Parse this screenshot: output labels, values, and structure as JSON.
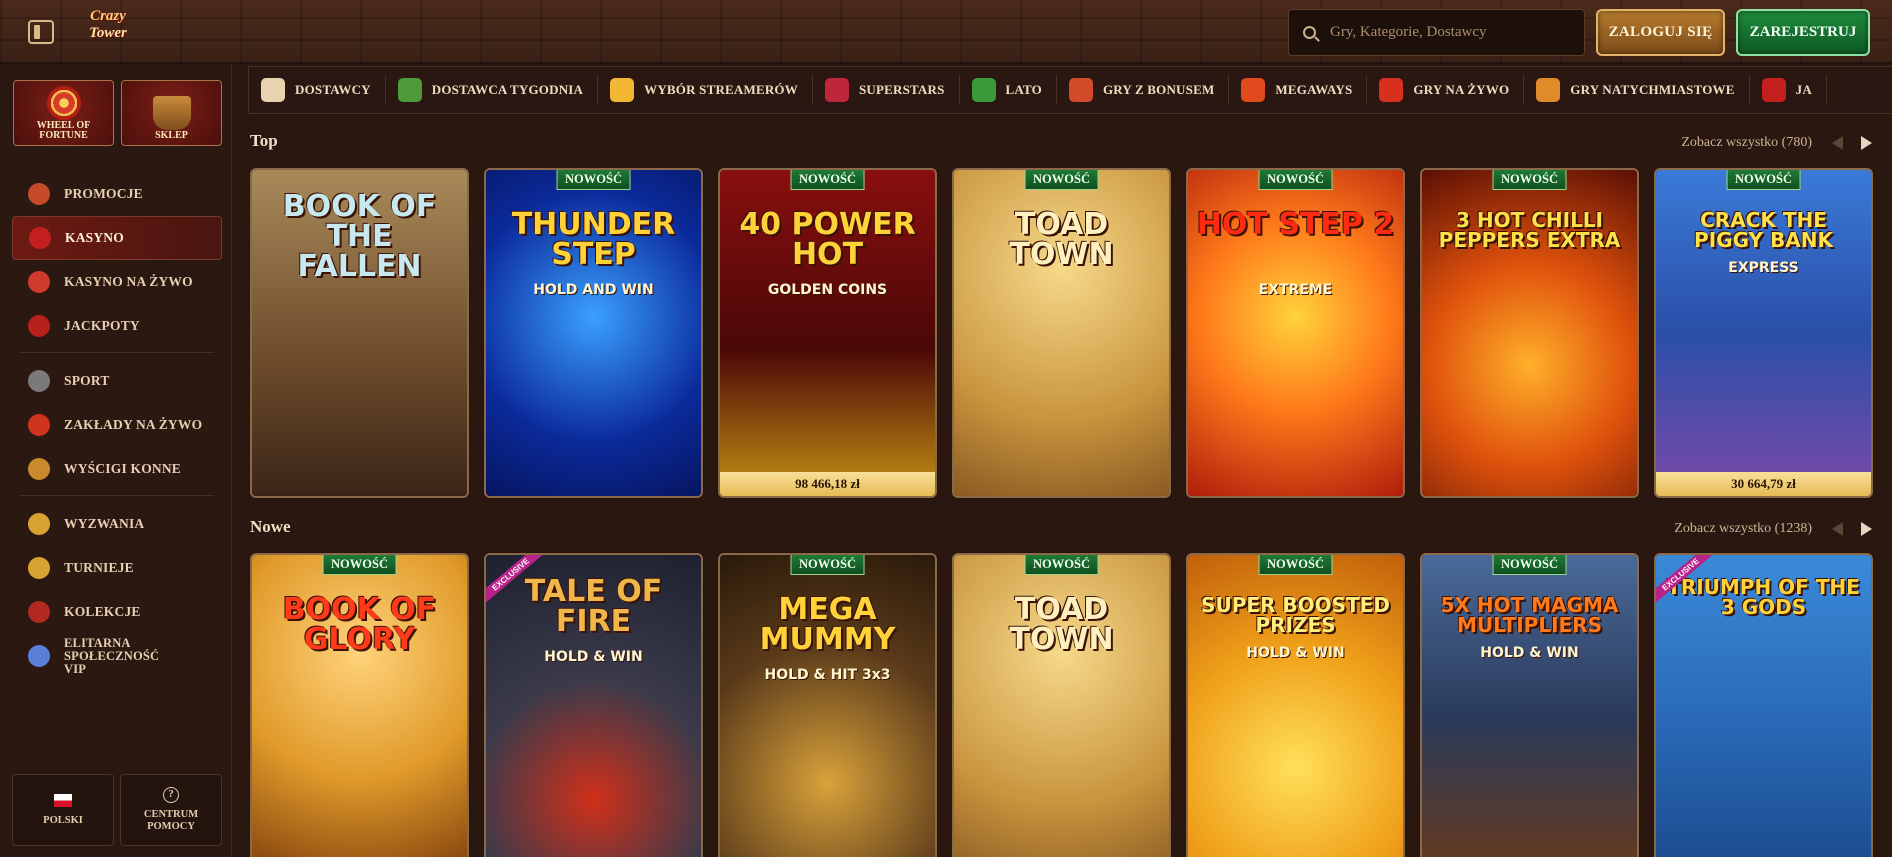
{
  "header": {
    "logo_line1": "Crazy",
    "logo_line2": "Tower",
    "search_placeholder": "Gry, Kategorie, Dostawcy",
    "login_label": "ZALOGUJ SIĘ",
    "register_label": "ZAREJESTRUJ"
  },
  "sidebar": {
    "tiles": [
      {
        "label": "WHEEL OF FORTUNE",
        "icon": "wheel-icon"
      },
      {
        "label": "SKLEP",
        "icon": "basket-icon"
      }
    ],
    "items": [
      {
        "label": "PROMOCJE",
        "icon": "gift-icon",
        "color": "#c44a2a"
      },
      {
        "label": "KASYNO",
        "icon": "cherries-icon",
        "color": "#c41f1f",
        "active": true
      },
      {
        "label": "KASYNO NA ŻYWO",
        "icon": "chip-icon",
        "color": "#d03a2c"
      },
      {
        "label": "JACKPOTY",
        "icon": "seven-icon",
        "color": "#b8201b"
      },
      {
        "label": "SPORT",
        "icon": "football-icon",
        "color": "#7a7a7a"
      },
      {
        "label": "ZAKŁADY NA ŻYWO",
        "icon": "live-icon",
        "color": "#d0331e"
      },
      {
        "label": "WYŚCIGI KONNE",
        "icon": "horse-icon",
        "color": "#c98a2c"
      },
      {
        "label": "WYZWANIA",
        "icon": "medal-icon",
        "color": "#d9a332"
      },
      {
        "label": "TURNIEJE",
        "icon": "trophy-icon",
        "color": "#d9a332"
      },
      {
        "label": "KOLEKCJE",
        "icon": "cards-icon",
        "color": "#b0281f"
      },
      {
        "label": "ELITARNA SPOŁECZNOŚĆ VIP",
        "icon": "diamond-icon",
        "color": "#5a7fd8"
      }
    ],
    "language_label": "POLSKI",
    "help_label": "CENTRUM POMOCY"
  },
  "categories": [
    {
      "label": "DOSTAWCY",
      "icon": "scroll-icon",
      "color": "#e8d2b0"
    },
    {
      "label": "DOSTAWCA TYGODNIA",
      "icon": "banknote-icon",
      "color": "#4f9a3a"
    },
    {
      "label": "WYBÓR STREAMERÓW",
      "icon": "lightning-icon",
      "color": "#f2b733"
    },
    {
      "label": "SUPERSTARS",
      "icon": "gem-icon",
      "color": "#c0263a"
    },
    {
      "label": "LATO",
      "icon": "watermelon-icon",
      "color": "#3a9a3a"
    },
    {
      "label": "GRY Z BONUSEM",
      "icon": "giftbox-icon",
      "color": "#d24a2a"
    },
    {
      "label": "MEGAWAYS",
      "icon": "m-icon",
      "color": "#e04a1c"
    },
    {
      "label": "GRY NA ŻYWO",
      "icon": "roulette-icon",
      "color": "#d8301f"
    },
    {
      "label": "GRY NATYCHMIASTOWE",
      "icon": "joystick-icon",
      "color": "#e08a2a"
    },
    {
      "label": "JA",
      "icon": "seven-icon",
      "color": "#c41f1f"
    }
  ],
  "sections": [
    {
      "title": "Top",
      "see_all": "Zobacz wszystko (780)",
      "games": [
        {
          "title": "BOOK OF THE FALLEN",
          "new": false,
          "exclusive": false,
          "jackpot": "",
          "bg": "linear-gradient(#a88a5a, #6b4a2a 60%, #3a2618)",
          "title_color": "#c8e8f0"
        },
        {
          "title": "THUNDER STEP",
          "subtitle": "HOLD AND WIN",
          "new": true,
          "exclusive": false,
          "jackpot": "",
          "bg": "radial-gradient(circle at 50% 45%, #3aa0ff, #0b2a9a 60%, #061560)",
          "title_color": "#ffd23a"
        },
        {
          "title": "40 POWER HOT",
          "subtitle": "GOLDEN COINS",
          "new": true,
          "exclusive": false,
          "jackpot": "98 466,18 zł",
          "bg": "linear-gradient(#8a0f0f, #4a0707 55%, #c79214)",
          "title_color": "#ffd23a"
        },
        {
          "title": "TOAD TOWN",
          "new": true,
          "exclusive": false,
          "jackpot": "",
          "bg": "radial-gradient(circle at 50% 30%, #f6d98a, #c9953e 60%, #8a5a22)",
          "title_color": "#fff0c0"
        },
        {
          "title": "HOT STEP 2",
          "subtitle": "EXTREME",
          "new": true,
          "exclusive": false,
          "jackpot": "",
          "bg": "radial-gradient(circle at 50% 45%, #ffd23a, #ff7a1a 45%, #b01c0c)",
          "title_color": "#ff2a12"
        },
        {
          "title": "3 HOT CHILLI PEPPERS EXTRA",
          "new": true,
          "exclusive": false,
          "jackpot": "",
          "bg": "radial-gradient(circle at 50% 60%, #ffb02a, #e0520c 45%, #5a0f05)",
          "title_color": "#ffe14a"
        },
        {
          "title": "CRACK THE PIGGY BANK",
          "subtitle": "EXPRESS",
          "new": true,
          "exclusive": false,
          "jackpot": "30 664,79 zł",
          "bg": "linear-gradient(#3a7ad8, #2a4fa8 50%, #7a4aa8)",
          "title_color": "#ffe14a"
        }
      ]
    },
    {
      "title": "Nowe",
      "see_all": "Zobacz wszystko (1238)",
      "games": [
        {
          "title": "BOOK OF GLORY",
          "new": true,
          "exclusive": false,
          "jackpot": "",
          "bg": "radial-gradient(circle at 50% 30%, #ffd27a, #e09a2a 50%, #7a3a0a)",
          "title_color": "#ff3a1a"
        },
        {
          "title": "TALE OF FIRE",
          "subtitle": "HOLD & WIN",
          "new": false,
          "exclusive": true,
          "jackpot": "",
          "bg": "radial-gradient(circle at 50% 75%, #d0301a, #3a3a4a 45%, #1e2030)",
          "title_color": "#f0b64a"
        },
        {
          "title": "MEGA MUMMY",
          "subtitle": "HOLD & HIT 3x3",
          "new": true,
          "exclusive": false,
          "jackpot": "",
          "bg": "radial-gradient(circle at 50% 70%, #d9a23a, #5a3a1a 55%, #2a1a0a)",
          "title_color": "#ffd23a"
        },
        {
          "title": "TOAD TOWN",
          "new": true,
          "exclusive": false,
          "jackpot": "",
          "bg": "radial-gradient(circle at 50% 30%, #f6d98a, #c9953e 60%, #8a5a22)",
          "title_color": "#fff0c0"
        },
        {
          "title": "SUPER BOOSTED PRIZES",
          "subtitle": "HOLD & WIN",
          "new": true,
          "exclusive": false,
          "jackpot": "",
          "bg": "radial-gradient(circle at 50% 65%, #ffe05a, #f0a01a 50%, #c0600a)",
          "title_color": "#ffef7a"
        },
        {
          "title": "5X HOT MAGMA MULTIPLIERS",
          "subtitle": "HOLD & WIN",
          "new": true,
          "exclusive": false,
          "jackpot": "",
          "bg": "linear-gradient(#4a6a9a, #2a3a5a 50%, #6a3a1a)",
          "title_color": "#ff7a1a"
        },
        {
          "title": "TRIUMPH OF THE 3 GODS",
          "new": false,
          "exclusive": true,
          "jackpot": "",
          "bg": "linear-gradient(#3a8ad8, #2a6ab8 50%, #1a4a8a)",
          "title_color": "#ffd23a"
        }
      ]
    }
  ],
  "badge_new": "NOWOŚĆ",
  "badge_exclusive": "EXCLUSIVE"
}
